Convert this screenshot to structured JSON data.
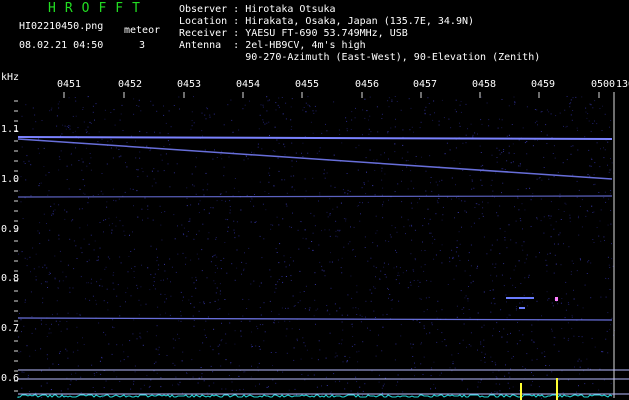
{
  "header": {
    "brand": "HROFFT",
    "filename": "HI02210450.png",
    "datetime": "08.02.21 04:50",
    "meteor_label": "meteor",
    "meteor_count": "3"
  },
  "info": {
    "observer": "Observer : Hirotaka Otsuka",
    "location": "Location : Hirakata, Osaka, Japan (135.7E, 34.9N)",
    "receiver": "Receiver : YAESU FT-690 53.749MHz, USB",
    "antenna": "Antenna  : 2el-HB9CV, 4m's high",
    "antenna2": "           90-270-Azimuth (East-West), 90-Elevation (Zenith)"
  },
  "axes": {
    "y_unit": "kHz",
    "time_ticks": [
      "0451",
      "0452",
      "0453",
      "0454",
      "0455",
      "0456",
      "0457",
      "0458",
      "0459",
      "0500"
    ],
    "time_tail": "130",
    "freq_ticks": [
      "1.1",
      "1.0",
      "0.9",
      "0.8",
      "0.7",
      "0.6"
    ]
  },
  "colors": {
    "background": "#000000",
    "brand": "#22dd22",
    "text": "#ffffff",
    "noise": "#2a2a8c",
    "signal": "#7a82ff"
  }
}
